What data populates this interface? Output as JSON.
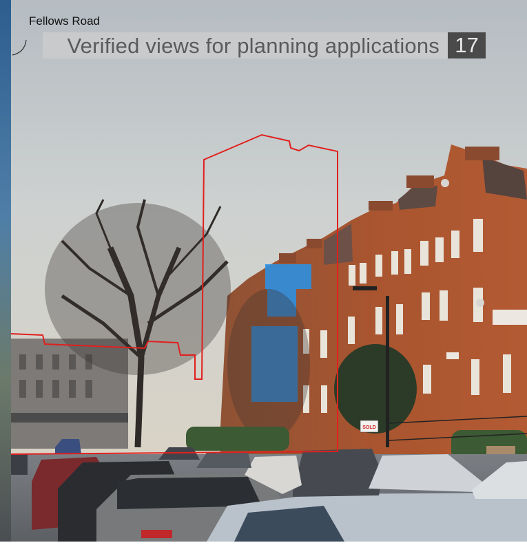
{
  "header": {
    "location": "Fellows Road",
    "title": "Verified views for planning applications",
    "page_number": "17"
  },
  "photo": {
    "sold_sign": "SOLD",
    "outline_color": "#e0201e",
    "sky_color": "#c9cfd2",
    "brick_color": "#a8502e"
  }
}
